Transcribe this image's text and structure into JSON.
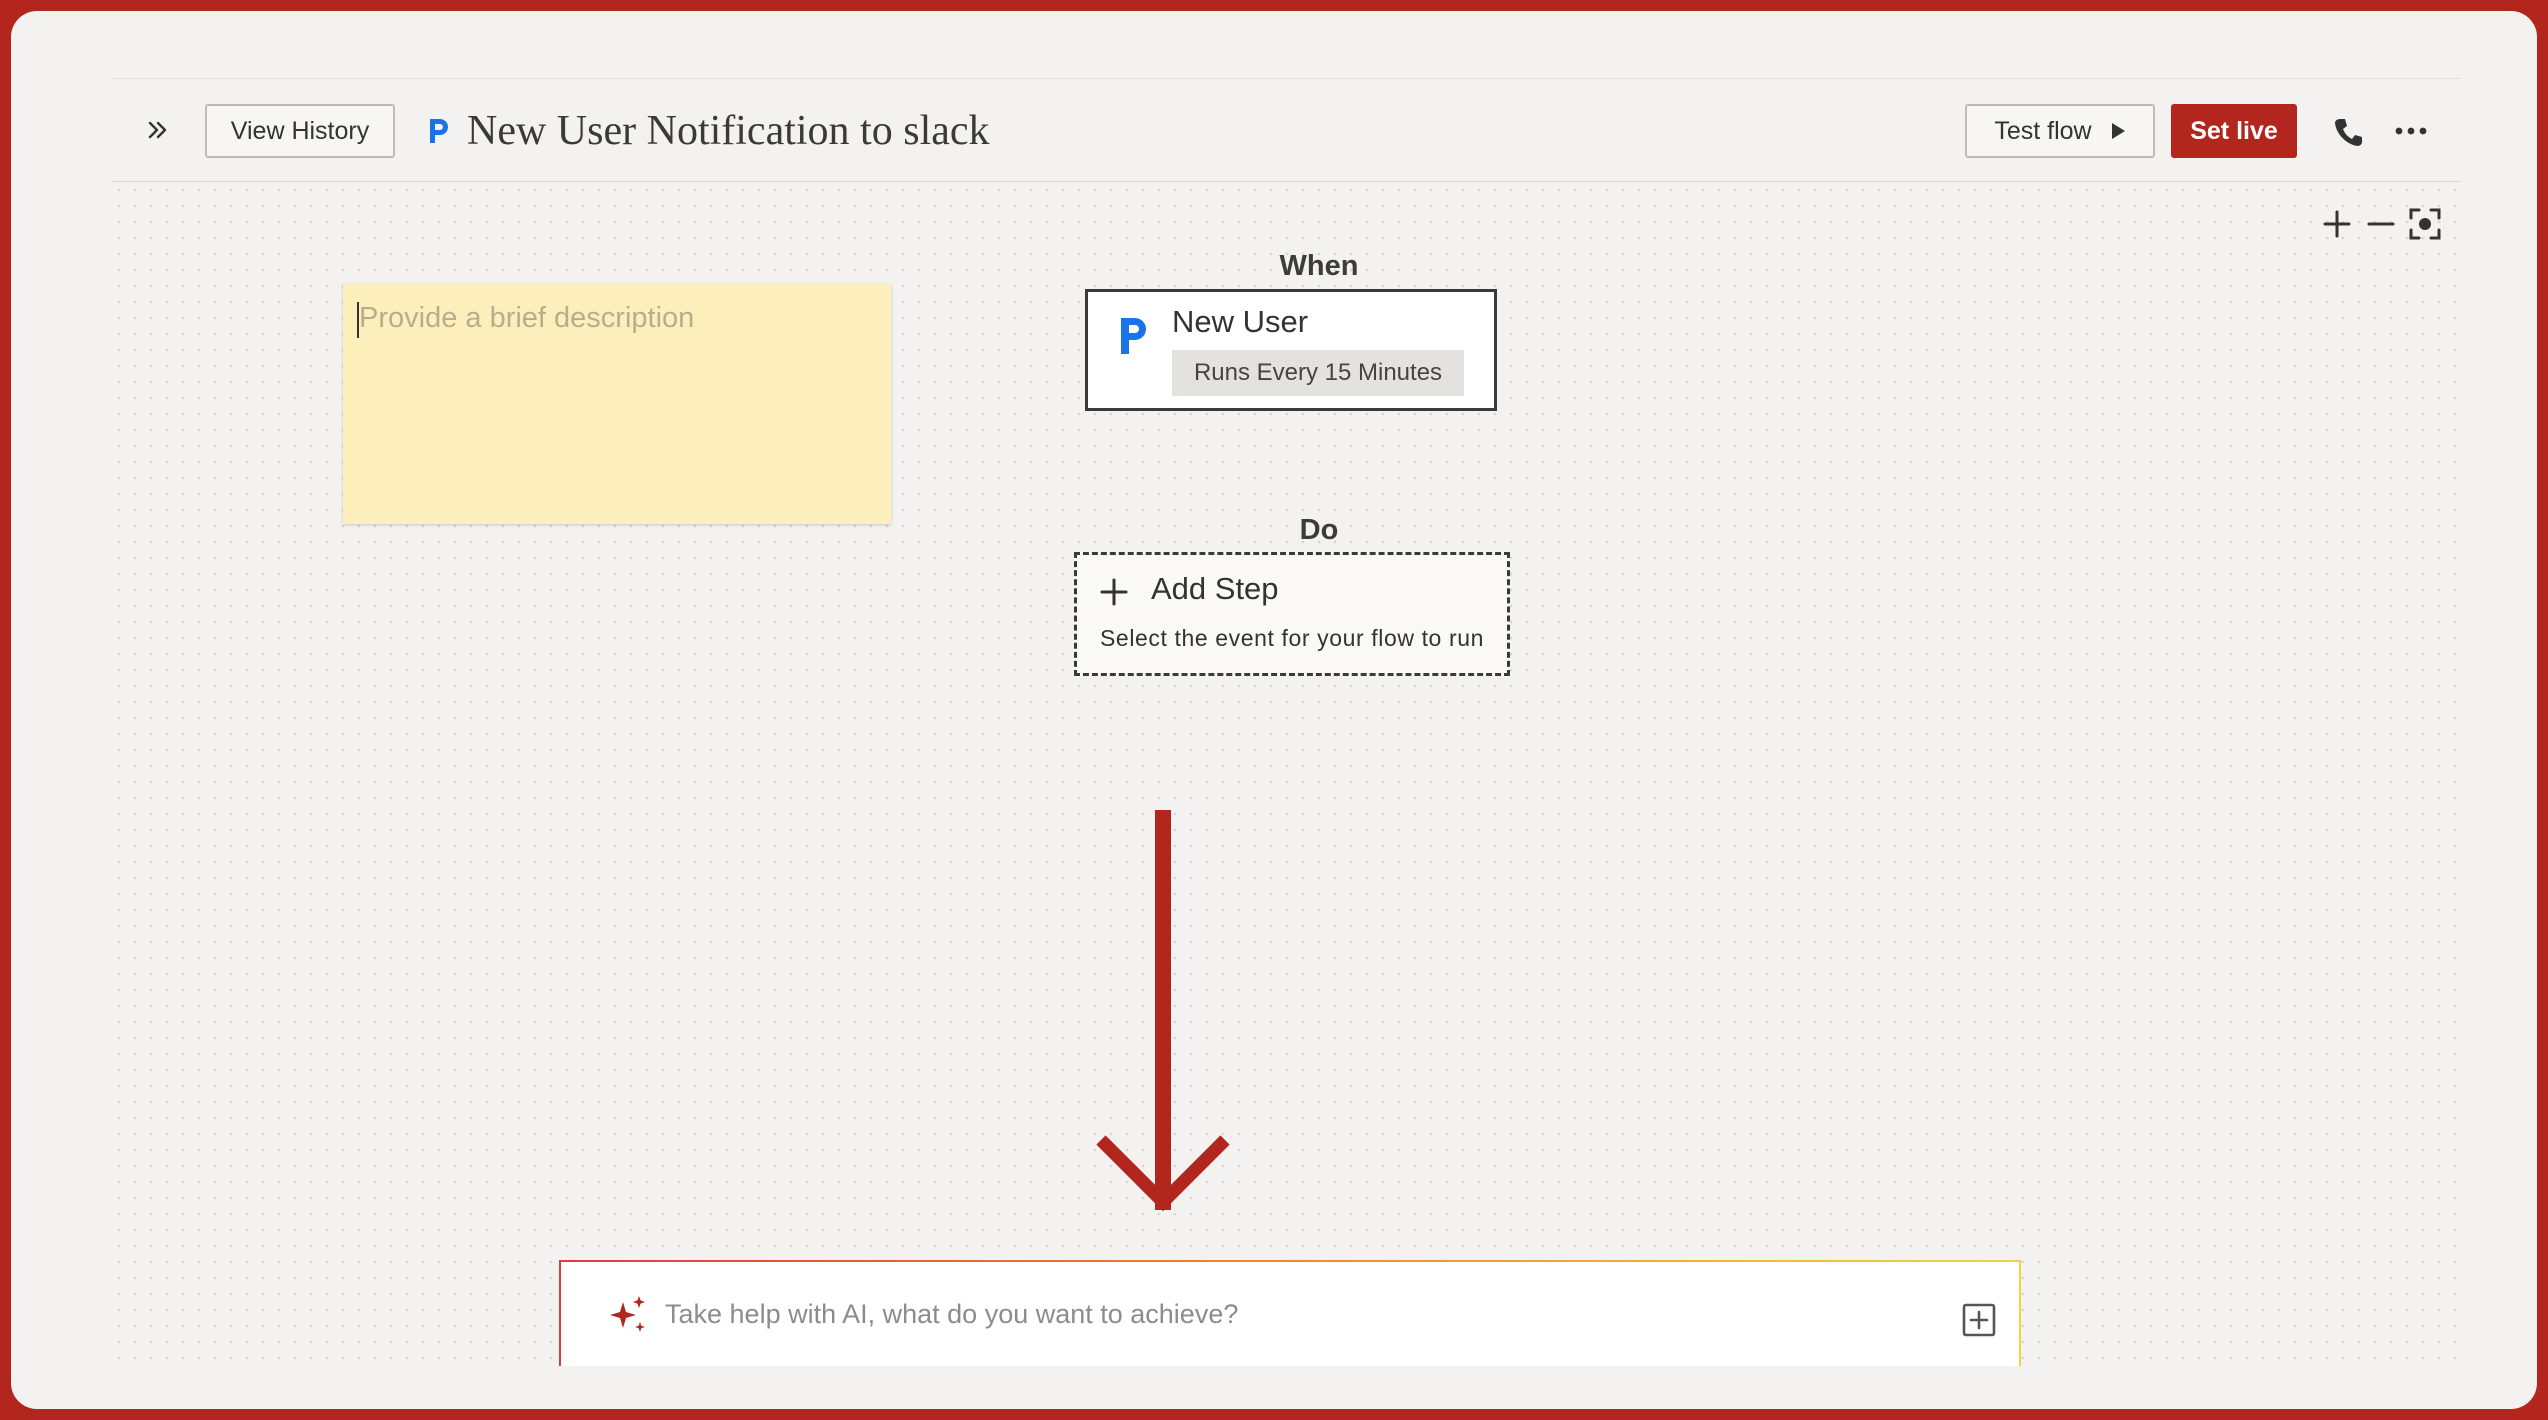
{
  "header": {
    "view_history_label": "View History",
    "flow_title": "New User Notification to slack",
    "test_flow_label": "Test flow",
    "set_live_label": "Set live"
  },
  "canvas": {
    "sticky_note": {
      "placeholder": "Provide a brief description"
    },
    "when_label": "When",
    "trigger": {
      "title": "New User",
      "schedule": "Runs Every 15 Minutes"
    },
    "do_label": "Do",
    "add_step": {
      "title": "Add Step",
      "subtitle": "Select the event for your flow to run"
    }
  },
  "ai_bar": {
    "placeholder": "Take help with AI, what do you want to achieve?"
  },
  "colors": {
    "accent": "#b3261e",
    "canvas_bg": "#f3f2f0",
    "sticky_note": "#fdefbb",
    "app_icon_blue": "#1a73e8"
  },
  "icons": [
    "expand-sidebar-icon",
    "app-logo-icon",
    "play-icon",
    "phone-icon",
    "more-options-icon",
    "zoom-in-icon",
    "zoom-out-icon",
    "fit-view-icon",
    "plus-icon",
    "ai-sparkle-icon",
    "add-attachment-icon",
    "down-arrow-annotation"
  ]
}
